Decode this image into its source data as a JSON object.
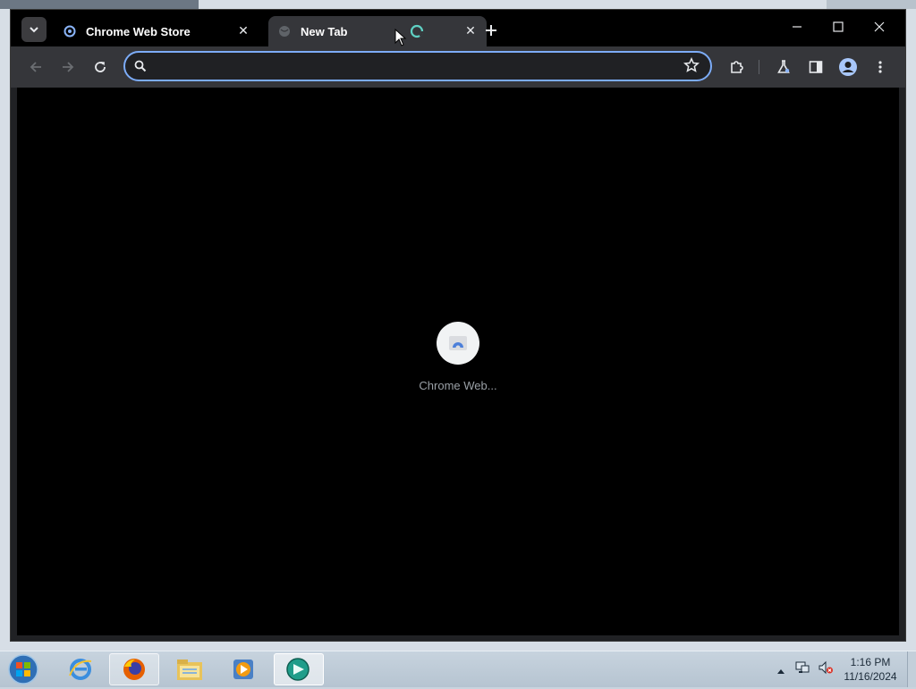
{
  "browser": {
    "tabs": [
      {
        "title": "Chrome Web Store",
        "favicon": "chrome-web-store-icon",
        "active": false
      },
      {
        "title": "New Tab",
        "favicon": "globe-icon",
        "active": true,
        "loading": true
      }
    ],
    "omnibox": {
      "value": "",
      "placeholder": ""
    },
    "content": {
      "loading_label": "Chrome Web..."
    },
    "colors": {
      "tabstrip": "#000000",
      "toolbar": "#35363a",
      "omnibox_border": "#7cacf8",
      "page": "#000000"
    }
  },
  "taskbar": {
    "items": [
      "internet-explorer-icon",
      "firefox-icon",
      "file-explorer-icon",
      "media-player-icon",
      "chrome-web-store-app-icon"
    ],
    "clock": {
      "time": "1:16 PM",
      "date": "11/16/2024"
    }
  }
}
